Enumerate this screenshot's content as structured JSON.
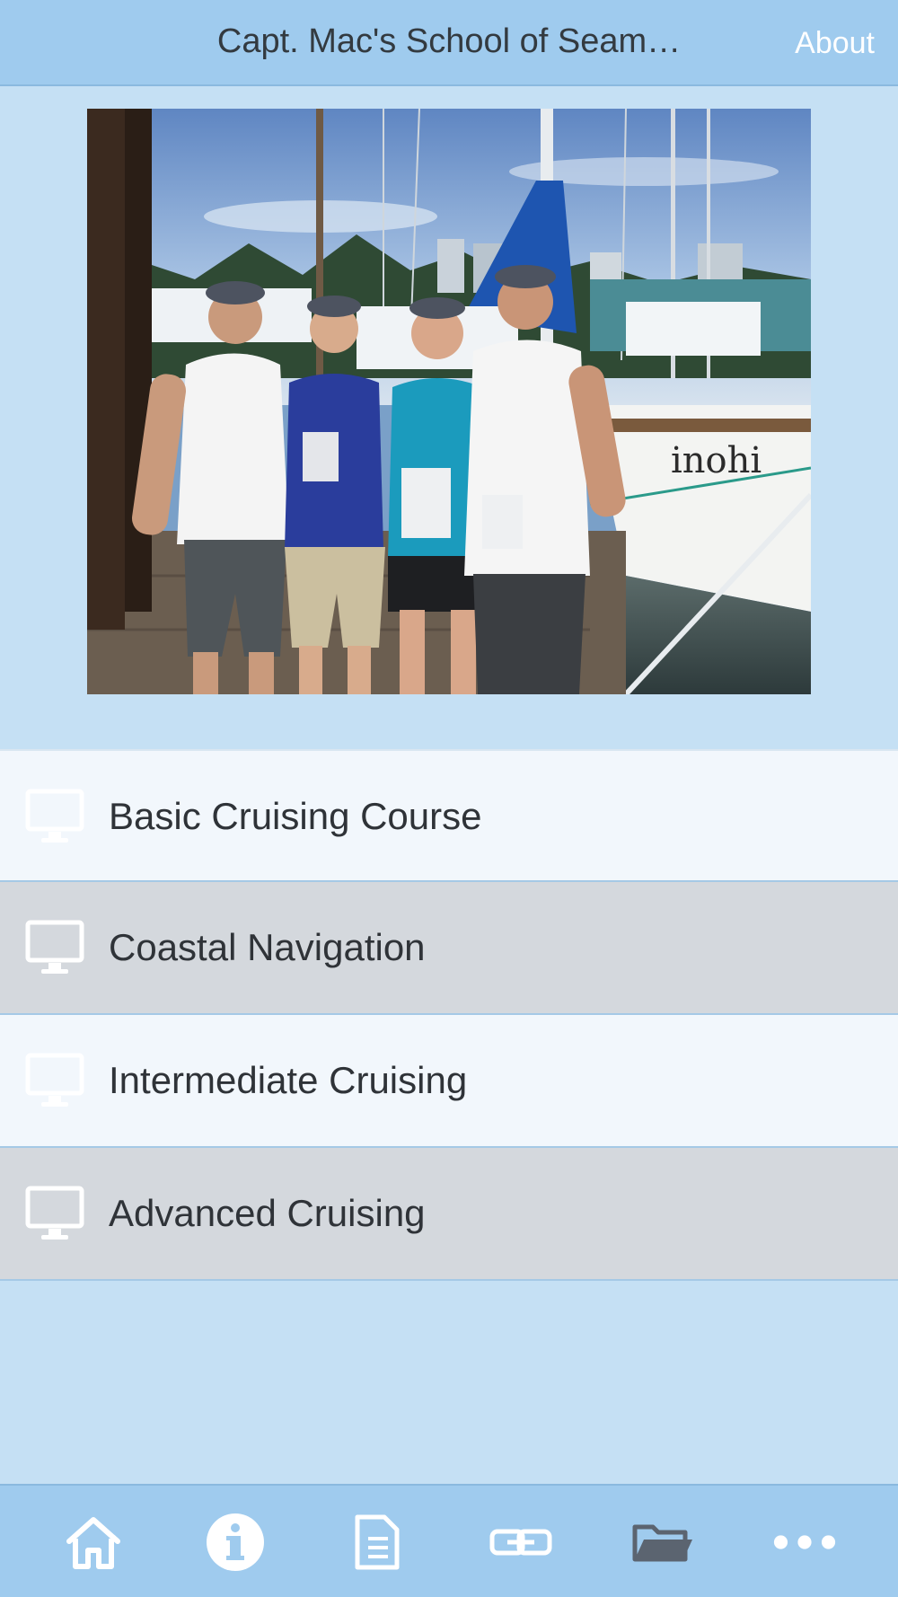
{
  "header": {
    "title": "Capt. Mac's School of Seam…",
    "about_label": "About"
  },
  "hero": {
    "boat_name_text": "inohi"
  },
  "list": {
    "items": [
      {
        "label": "Basic Cruising Course",
        "icon": "monitor-icon"
      },
      {
        "label": "Coastal Navigation",
        "icon": "monitor-icon"
      },
      {
        "label": "Intermediate Cruising",
        "icon": "monitor-icon"
      },
      {
        "label": "Advanced Cruising",
        "icon": "monitor-icon"
      }
    ]
  },
  "tabbar": {
    "tabs": [
      {
        "icon": "home-icon"
      },
      {
        "icon": "info-icon"
      },
      {
        "icon": "document-icon"
      },
      {
        "icon": "link-icon"
      },
      {
        "icon": "folder-icon"
      },
      {
        "icon": "more-icon"
      }
    ]
  },
  "colors": {
    "background": "#c5e0f4",
    "header": "#9fcbee",
    "row_light": "#f2f7fc",
    "row_dark": "#d4d8dd",
    "text": "#2f3338"
  }
}
